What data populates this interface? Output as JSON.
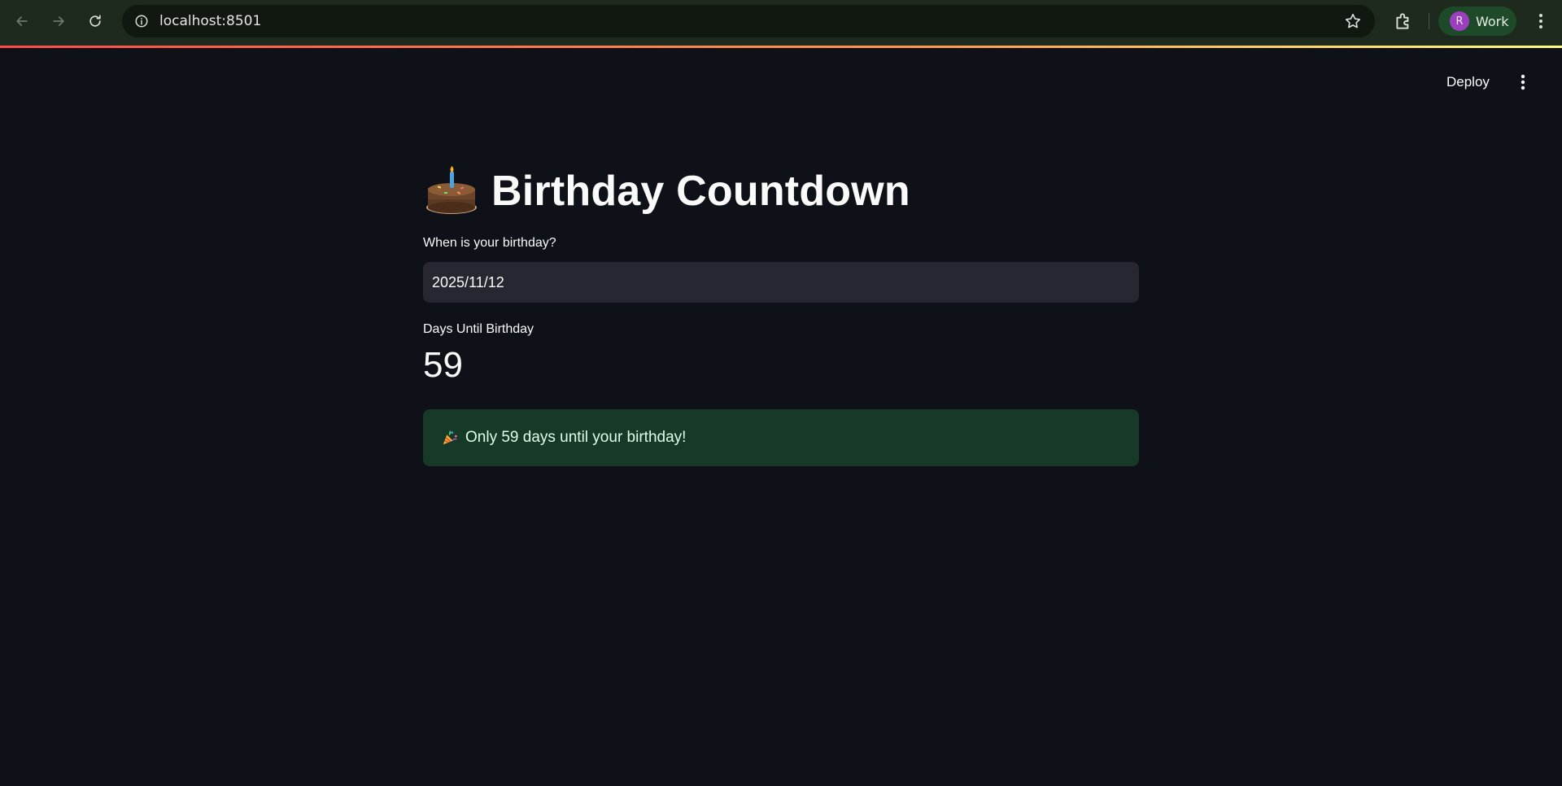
{
  "browser": {
    "url": "localhost:8501",
    "profile_initial": "R",
    "profile_name": "Work",
    "icons": {
      "back": "arrow-left-icon",
      "forward": "arrow-right-icon",
      "reload": "reload-icon",
      "site_info": "info-icon",
      "bookmark": "star-icon",
      "extensions": "puzzle-icon",
      "menu": "kebab-menu-icon"
    },
    "colors": {
      "toolbar": "#1f2a1e",
      "omnibox": "#101810",
      "profile_chip": "#1f4a2a",
      "avatar": "#9c3fbe"
    }
  },
  "app_header": {
    "deploy_label": "Deploy",
    "menu_icon": "kebab-menu-icon"
  },
  "main": {
    "title": "Birthday Countdown",
    "title_icon": "birthday-cake-icon",
    "date_input": {
      "label": "When is your birthday?",
      "value": "2025/11/12"
    },
    "metric": {
      "label": "Days Until Birthday",
      "value": "59"
    },
    "success_message": {
      "icon": "party-popper-icon",
      "text": "Only 59 days until your birthday!"
    }
  },
  "theme": {
    "background": "#0e1117",
    "input_background": "#262730",
    "success_background": "#173928",
    "success_text": "#dffde9",
    "text": "#fafafa"
  }
}
